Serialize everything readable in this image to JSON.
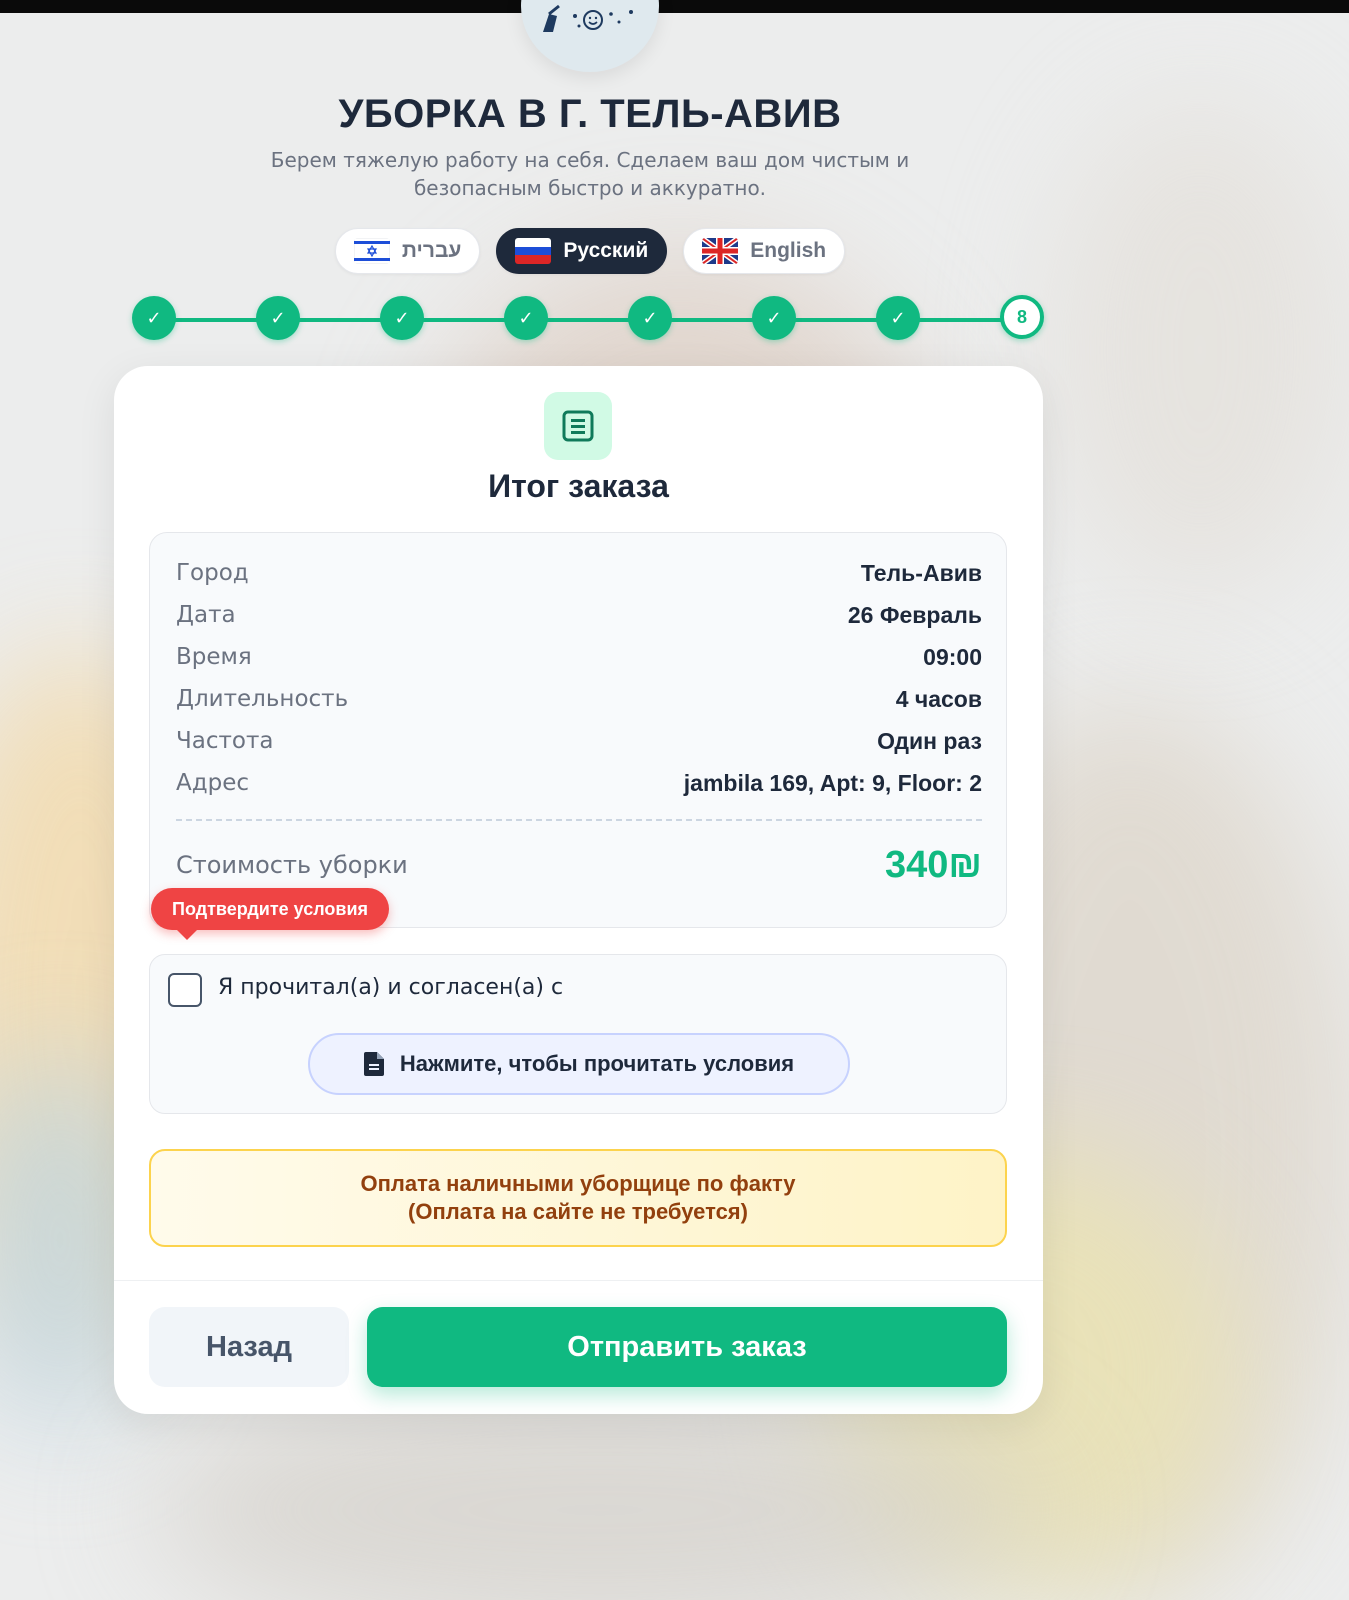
{
  "header": {
    "title": "УБОРКА В Г. ТЕЛЬ-АВИВ",
    "subtitle_line1": "Берем тяжелую работу на себя. Сделаем ваш дом чистым и",
    "subtitle_line2": "безопасным быстро и аккуратно."
  },
  "languages": [
    {
      "label": "עברית",
      "flag": "israel-flag-icon",
      "active": false
    },
    {
      "label": "Русский",
      "flag": "russia-flag-icon",
      "active": true
    },
    {
      "label": "English",
      "flag": "uk-flag-icon",
      "active": false
    }
  ],
  "stepper": {
    "completed_mark": "✓",
    "current_step": "8",
    "total_steps": 8
  },
  "summary": {
    "title": "Итог заказа",
    "icon": "receipt-icon",
    "rows": [
      {
        "key": "Город",
        "value": "Тель-Авив"
      },
      {
        "key": "Дата",
        "value": "26 Февраль"
      },
      {
        "key": "Время",
        "value": "09:00"
      },
      {
        "key": "Длительность",
        "value": "4 часов"
      },
      {
        "key": "Частота",
        "value": "Один раз"
      },
      {
        "key": "Адрес",
        "value": "jambila 169, Apt: 9, Floor: 2"
      }
    ],
    "price_label": "Стоимость уборки",
    "price_value": "340₪"
  },
  "terms": {
    "tooltip": "Подтвердите условия",
    "checkbox_label": "Я прочитал(а) и согласен(а) с",
    "read_button": "Нажмите, чтобы прочитать условия"
  },
  "payment": {
    "line1": "Оплата наличными уборщице по факту",
    "line2": "(Оплата на сайте не требуется)"
  },
  "actions": {
    "back": "Назад",
    "submit": "Отправить заказ"
  },
  "colors": {
    "accent": "#10b981",
    "dark": "#1e293b",
    "error": "#ef4444",
    "warning_text": "#92400e"
  }
}
